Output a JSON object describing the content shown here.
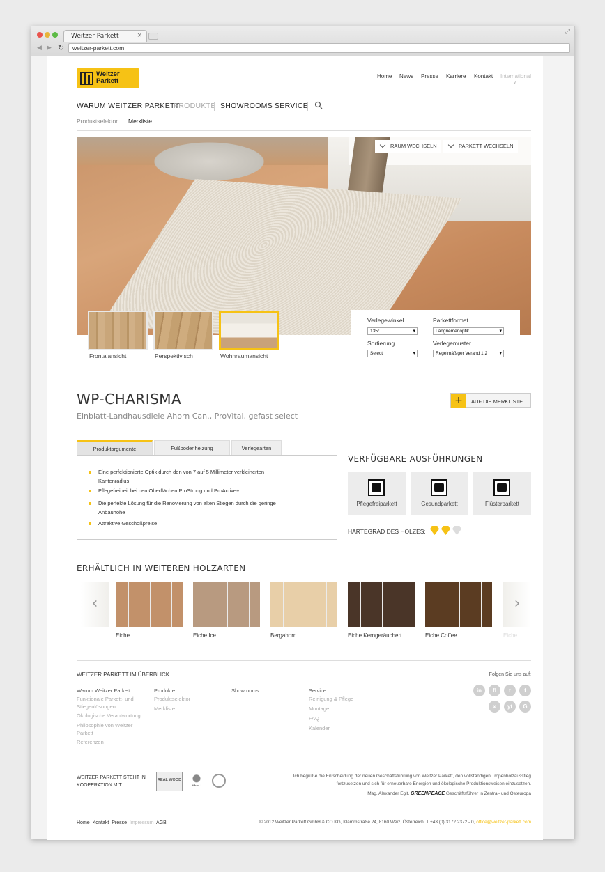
{
  "browser": {
    "tab_title": "Weitzer Parkett",
    "tab_close": "×",
    "url": "weitzer-parkett.com",
    "expand_icon": "⤢"
  },
  "logo": {
    "line1": "Weitzer",
    "line2": "Parkett"
  },
  "top_nav": [
    "Home",
    "News",
    "Presse",
    "Karriere",
    "Kontakt",
    "International"
  ],
  "main_nav": [
    "WARUM WEITZER PARKETT",
    "PRODUKTE",
    "SHOWROOMS",
    "SERVICE"
  ],
  "sub_nav": [
    "Produktselektor",
    "Merkliste"
  ],
  "hero": {
    "raum_button": "RAUM WECHSELN",
    "parkett_button": "PARKETT WECHSELN"
  },
  "views": [
    "Frontalansicht",
    "Perspektivisch",
    "Wohnraumansicht"
  ],
  "configurator": {
    "verlegewinkel_label": "Verlegewinkel",
    "verlegewinkel_value": "135°",
    "parkettformat_label": "Parkettformat",
    "parkettformat_value": "Langriemenoptik",
    "sortierung_label": "Sortierung",
    "sortierung_value": "Select",
    "verlegemuster_label": "Verlegemuster",
    "verlegemuster_value": "Regelmäßiger Verand 1:2"
  },
  "product": {
    "title": "WP-CHARISMA",
    "subtitle": "Einblatt-Landhausdiele Ahorn Can., ProVital, gefast select",
    "merkliste_button": "AUF DIE MERKLISTE",
    "merkliste_plus": "+"
  },
  "tabs": [
    "Produktargumente",
    "Fußbodenheizung",
    "Verlegearten"
  ],
  "arguments": [
    "Eine perfektionierte Optik durch den von 7 auf 5 Millimeter verkleinerten Kantenradius",
    "Pflegefreiheit bei den Oberflächen ProStrong und ProActive+",
    "Die perfekte Lösung für die Renovierung von alten Stiegen durch die geringe Anbauhöhe",
    "Attraktive Geschoßpreise"
  ],
  "ausfuehrungen": {
    "heading": "VERFÜGBARE AUSFÜHRUNGEN",
    "items": [
      "Pflegefreiparkett",
      "Gesundparkett",
      "Flüsterparkett"
    ],
    "haertegrad_label": "HÄRTEGRAD DES HOLZES:",
    "haertegrad_level": 2,
    "haertegrad_max": 3,
    "gem_color": "#f6c215"
  },
  "holzarten": {
    "heading": "ERHÄLTLICH IN WEITEREN HOLZARTEN",
    "prev": "‹",
    "next": "›",
    "items": [
      {
        "name": "Eiche",
        "color": "#c2916a"
      },
      {
        "name": "Eiche Ice",
        "color": "#b89a80"
      },
      {
        "name": "Bergahorn",
        "color": "#e8cfa8"
      },
      {
        "name": "Eiche Kerngeräuchert",
        "color": "#4a3528"
      },
      {
        "name": "Eiche Coffee",
        "color": "#5b3c22"
      }
    ],
    "faded": "Eiche"
  },
  "footer": {
    "heading": "WEITZER PARKETT IM ÜBERBLICK",
    "col1_title": "Warum Weitzer Parkett",
    "col1": [
      "Funktionale Parkett- und Stiegenlösungen",
      "Ökologische Verantwortung",
      "Philosophie von Weitzer Parkett",
      "Referenzen"
    ],
    "col2_title": "Produkte",
    "col2": [
      "Produktselektor",
      "Merkliste"
    ],
    "col3_title": "Showrooms",
    "col4_title": "Service",
    "col4": [
      "Reinigung & Pflege",
      "Montage",
      "FAQ",
      "Kalender"
    ],
    "social_title": "Folgen Sie uns auf:",
    "social": [
      "in",
      "fl",
      "t",
      "f",
      "x",
      "yt",
      "G"
    ],
    "koop": "WEITZER PARKETT STEHT IN KOOPERATION MIT:",
    "cert": [
      "REAL WOOD",
      "PEFC",
      "FSC"
    ],
    "quote": "Ich begrüße die Entscheidung der neuen Geschäftsführung von Weitzer Parkett, den vollständigen Tropenholzausstieg fortzusetzen und sich für erneuerbare Energien und ökologische Produktionsweisen einzusetzen.",
    "quote_author_pre": "Mag. Alexander Egit,",
    "quote_brand": "GREENPEACE",
    "quote_author_post": "Geschäftsführer in Zentral- und Osteuropa",
    "bottom_links": [
      "Home",
      "Kontakt",
      "Presse",
      "Impressum",
      "AGB"
    ],
    "copyright": "© 2012 Weitzer Parkett GmbH & CO KG, Klammstraße 24, 8160 Weiz, Österreich, T +43 (0) 3172 2372 - 0,",
    "email": "office@weitzer-parkett.com"
  },
  "colors": {
    "accent": "#f6c215"
  }
}
